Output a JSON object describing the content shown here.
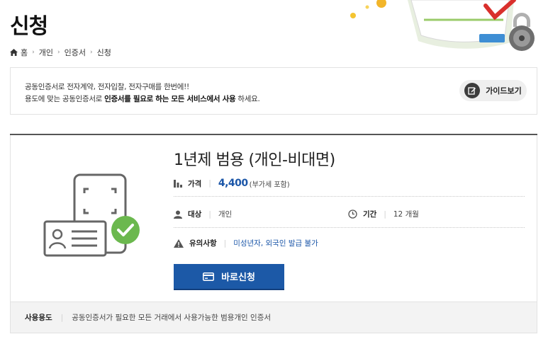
{
  "page": {
    "title": "신청"
  },
  "breadcrumb": [
    "홈",
    "개인",
    "인증서",
    "신청"
  ],
  "notice": {
    "line1": "공동인증서로 전자계약, 전자입찰, 전자구매를 한번에!!",
    "line2_a": "용도에 맞는 공동인증서로 ",
    "line2_b": "인증서를 필요로 하는 모든 서비스에서 사용",
    "line2_c": " 하세요.",
    "guide_button": "가이드보기"
  },
  "product": {
    "title": "1년제 범용 (개인-비대면)",
    "price_label": "가격",
    "price_value": "4,400",
    "price_note": "(부가세 포함)",
    "target_label": "대상",
    "target_value": "개인",
    "period_label": "기간",
    "period_value": "12 개월",
    "caution_label": "유의사항",
    "caution_value": "미성년자, 외국인 발급 불가",
    "apply_button": "바로신청",
    "usage_label": "사용용도",
    "usage_value": "공동인증서가 필요한 모든 거래에서 사용가능한 범용개인 인증서"
  },
  "colors": {
    "accent_blue": "#1c59a7",
    "price_blue": "#1b56a8",
    "check_green": "#6bb84e",
    "usage_bg": "#f3f3f3"
  },
  "icons": {
    "home": "home-icon",
    "guide": "guide-edit-icon",
    "price": "price-stack-icon",
    "target": "person-icon",
    "period": "clock-icon",
    "caution": "warning-icon",
    "apply": "card-icon"
  }
}
